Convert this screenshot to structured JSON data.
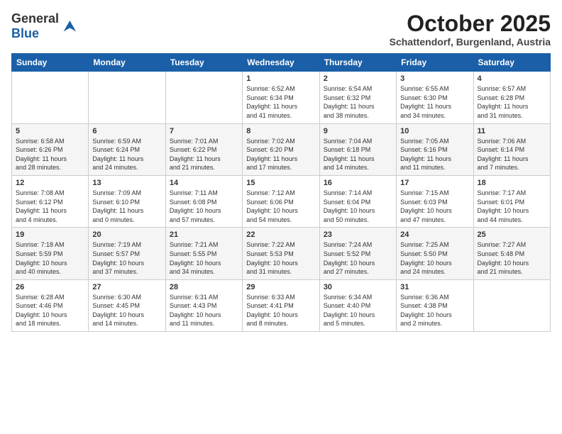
{
  "logo": {
    "general": "General",
    "blue": "Blue"
  },
  "header": {
    "month": "October 2025",
    "location": "Schattendorf, Burgenland, Austria"
  },
  "weekdays": [
    "Sunday",
    "Monday",
    "Tuesday",
    "Wednesday",
    "Thursday",
    "Friday",
    "Saturday"
  ],
  "weeks": [
    [
      {
        "day": "",
        "info": ""
      },
      {
        "day": "",
        "info": ""
      },
      {
        "day": "",
        "info": ""
      },
      {
        "day": "1",
        "info": "Sunrise: 6:52 AM\nSunset: 6:34 PM\nDaylight: 11 hours\nand 41 minutes."
      },
      {
        "day": "2",
        "info": "Sunrise: 6:54 AM\nSunset: 6:32 PM\nDaylight: 11 hours\nand 38 minutes."
      },
      {
        "day": "3",
        "info": "Sunrise: 6:55 AM\nSunset: 6:30 PM\nDaylight: 11 hours\nand 34 minutes."
      },
      {
        "day": "4",
        "info": "Sunrise: 6:57 AM\nSunset: 6:28 PM\nDaylight: 11 hours\nand 31 minutes."
      }
    ],
    [
      {
        "day": "5",
        "info": "Sunrise: 6:58 AM\nSunset: 6:26 PM\nDaylight: 11 hours\nand 28 minutes."
      },
      {
        "day": "6",
        "info": "Sunrise: 6:59 AM\nSunset: 6:24 PM\nDaylight: 11 hours\nand 24 minutes."
      },
      {
        "day": "7",
        "info": "Sunrise: 7:01 AM\nSunset: 6:22 PM\nDaylight: 11 hours\nand 21 minutes."
      },
      {
        "day": "8",
        "info": "Sunrise: 7:02 AM\nSunset: 6:20 PM\nDaylight: 11 hours\nand 17 minutes."
      },
      {
        "day": "9",
        "info": "Sunrise: 7:04 AM\nSunset: 6:18 PM\nDaylight: 11 hours\nand 14 minutes."
      },
      {
        "day": "10",
        "info": "Sunrise: 7:05 AM\nSunset: 6:16 PM\nDaylight: 11 hours\nand 11 minutes."
      },
      {
        "day": "11",
        "info": "Sunrise: 7:06 AM\nSunset: 6:14 PM\nDaylight: 11 hours\nand 7 minutes."
      }
    ],
    [
      {
        "day": "12",
        "info": "Sunrise: 7:08 AM\nSunset: 6:12 PM\nDaylight: 11 hours\nand 4 minutes."
      },
      {
        "day": "13",
        "info": "Sunrise: 7:09 AM\nSunset: 6:10 PM\nDaylight: 11 hours\nand 0 minutes."
      },
      {
        "day": "14",
        "info": "Sunrise: 7:11 AM\nSunset: 6:08 PM\nDaylight: 10 hours\nand 57 minutes."
      },
      {
        "day": "15",
        "info": "Sunrise: 7:12 AM\nSunset: 6:06 PM\nDaylight: 10 hours\nand 54 minutes."
      },
      {
        "day": "16",
        "info": "Sunrise: 7:14 AM\nSunset: 6:04 PM\nDaylight: 10 hours\nand 50 minutes."
      },
      {
        "day": "17",
        "info": "Sunrise: 7:15 AM\nSunset: 6:03 PM\nDaylight: 10 hours\nand 47 minutes."
      },
      {
        "day": "18",
        "info": "Sunrise: 7:17 AM\nSunset: 6:01 PM\nDaylight: 10 hours\nand 44 minutes."
      }
    ],
    [
      {
        "day": "19",
        "info": "Sunrise: 7:18 AM\nSunset: 5:59 PM\nDaylight: 10 hours\nand 40 minutes."
      },
      {
        "day": "20",
        "info": "Sunrise: 7:19 AM\nSunset: 5:57 PM\nDaylight: 10 hours\nand 37 minutes."
      },
      {
        "day": "21",
        "info": "Sunrise: 7:21 AM\nSunset: 5:55 PM\nDaylight: 10 hours\nand 34 minutes."
      },
      {
        "day": "22",
        "info": "Sunrise: 7:22 AM\nSunset: 5:53 PM\nDaylight: 10 hours\nand 31 minutes."
      },
      {
        "day": "23",
        "info": "Sunrise: 7:24 AM\nSunset: 5:52 PM\nDaylight: 10 hours\nand 27 minutes."
      },
      {
        "day": "24",
        "info": "Sunrise: 7:25 AM\nSunset: 5:50 PM\nDaylight: 10 hours\nand 24 minutes."
      },
      {
        "day": "25",
        "info": "Sunrise: 7:27 AM\nSunset: 5:48 PM\nDaylight: 10 hours\nand 21 minutes."
      }
    ],
    [
      {
        "day": "26",
        "info": "Sunrise: 6:28 AM\nSunset: 4:46 PM\nDaylight: 10 hours\nand 18 minutes."
      },
      {
        "day": "27",
        "info": "Sunrise: 6:30 AM\nSunset: 4:45 PM\nDaylight: 10 hours\nand 14 minutes."
      },
      {
        "day": "28",
        "info": "Sunrise: 6:31 AM\nSunset: 4:43 PM\nDaylight: 10 hours\nand 11 minutes."
      },
      {
        "day": "29",
        "info": "Sunrise: 6:33 AM\nSunset: 4:41 PM\nDaylight: 10 hours\nand 8 minutes."
      },
      {
        "day": "30",
        "info": "Sunrise: 6:34 AM\nSunset: 4:40 PM\nDaylight: 10 hours\nand 5 minutes."
      },
      {
        "day": "31",
        "info": "Sunrise: 6:36 AM\nSunset: 4:38 PM\nDaylight: 10 hours\nand 2 minutes."
      },
      {
        "day": "",
        "info": ""
      }
    ]
  ]
}
